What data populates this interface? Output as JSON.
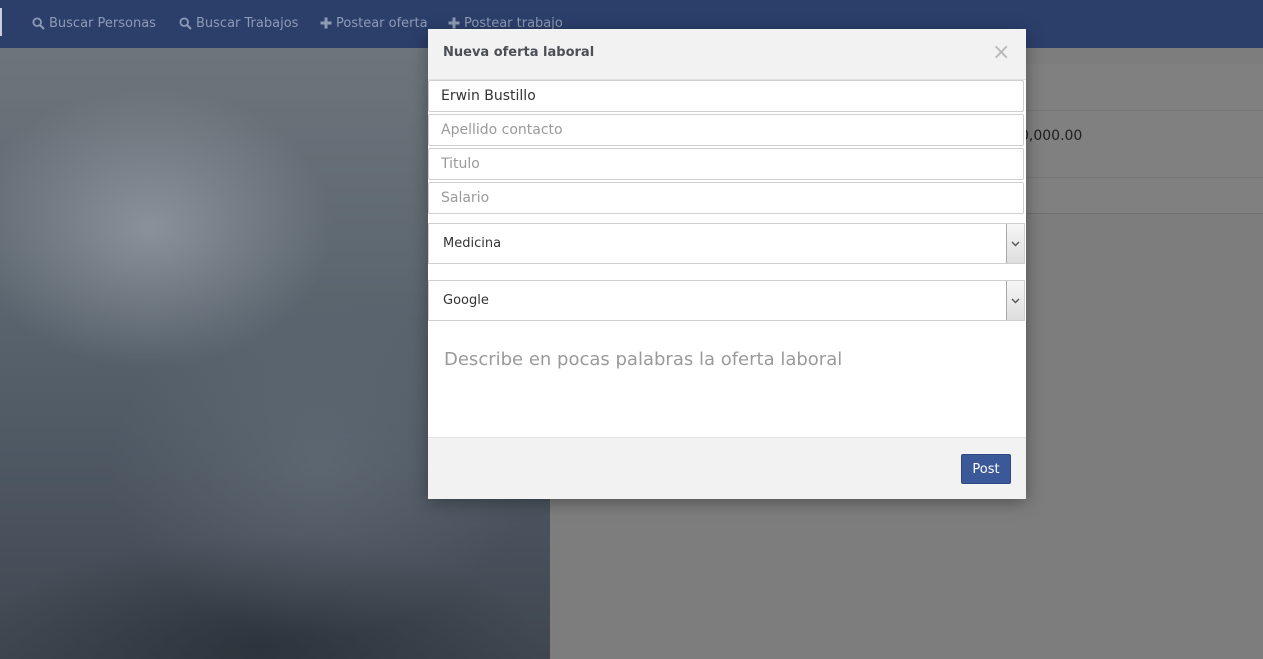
{
  "navbar": {
    "items": [
      {
        "label": "Buscar Personas",
        "icon": "search-icon"
      },
      {
        "label": "Buscar Trabajos",
        "icon": "search-icon"
      },
      {
        "label": "Postear oferta",
        "icon": "plus-icon"
      },
      {
        "label": "Postear trabajo",
        "icon": "plus-icon"
      }
    ],
    "background_color": "#2c3f6b"
  },
  "background_page": {
    "amount_text": "0,000.00"
  },
  "modal": {
    "title": "Nueva oferta laboral",
    "close_symbol": "×",
    "fields": {
      "contact_name_value": "Erwin Bustillo",
      "contact_lastname_placeholder": "Apellido contacto",
      "title_placeholder": "Titulo",
      "salary_placeholder": "Salario"
    },
    "category_select": {
      "selected": "Medicina"
    },
    "company_select": {
      "selected": "Google"
    },
    "description_placeholder": "Describe en pocas palabras la oferta laboral",
    "post_button_label": "Post",
    "accent_color": "#3b5998"
  }
}
